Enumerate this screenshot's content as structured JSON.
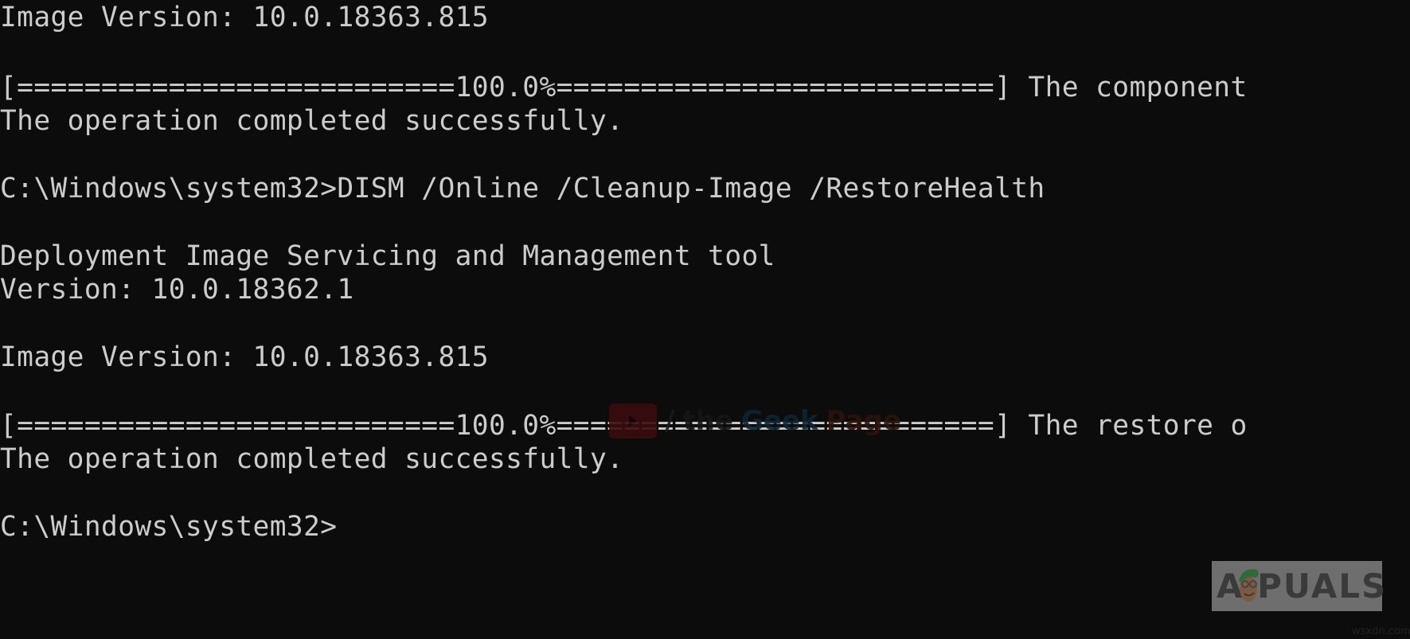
{
  "console": {
    "lines": [
      "Image Version: 10.0.18363.815",
      "",
      "[==========================100.0%==========================] The component",
      "The operation completed successfully.",
      "",
      "C:\\Windows\\system32>DISM /Online /Cleanup-Image /RestoreHealth",
      "",
      "Deployment Image Servicing and Management tool",
      "Version: 10.0.18362.1",
      "",
      "Image Version: 10.0.18363.815",
      "",
      "[==========================100.0%==========================] The restore o",
      "The operation completed successfully.",
      "",
      "C:\\Windows\\system32>"
    ],
    "progress": [
      {
        "percent": 100.0,
        "label": "100.0%"
      },
      {
        "percent": 100.0,
        "label": "100.0%"
      }
    ]
  },
  "watermarks": {
    "geek_page": {
      "slash": "/",
      "the": "the",
      "geek": "Geek",
      "page": "Page"
    },
    "appuals": "A PUALS",
    "site": "wsxdn.com"
  },
  "colors": {
    "background": "#0c0c0c",
    "text": "#cccccc"
  }
}
